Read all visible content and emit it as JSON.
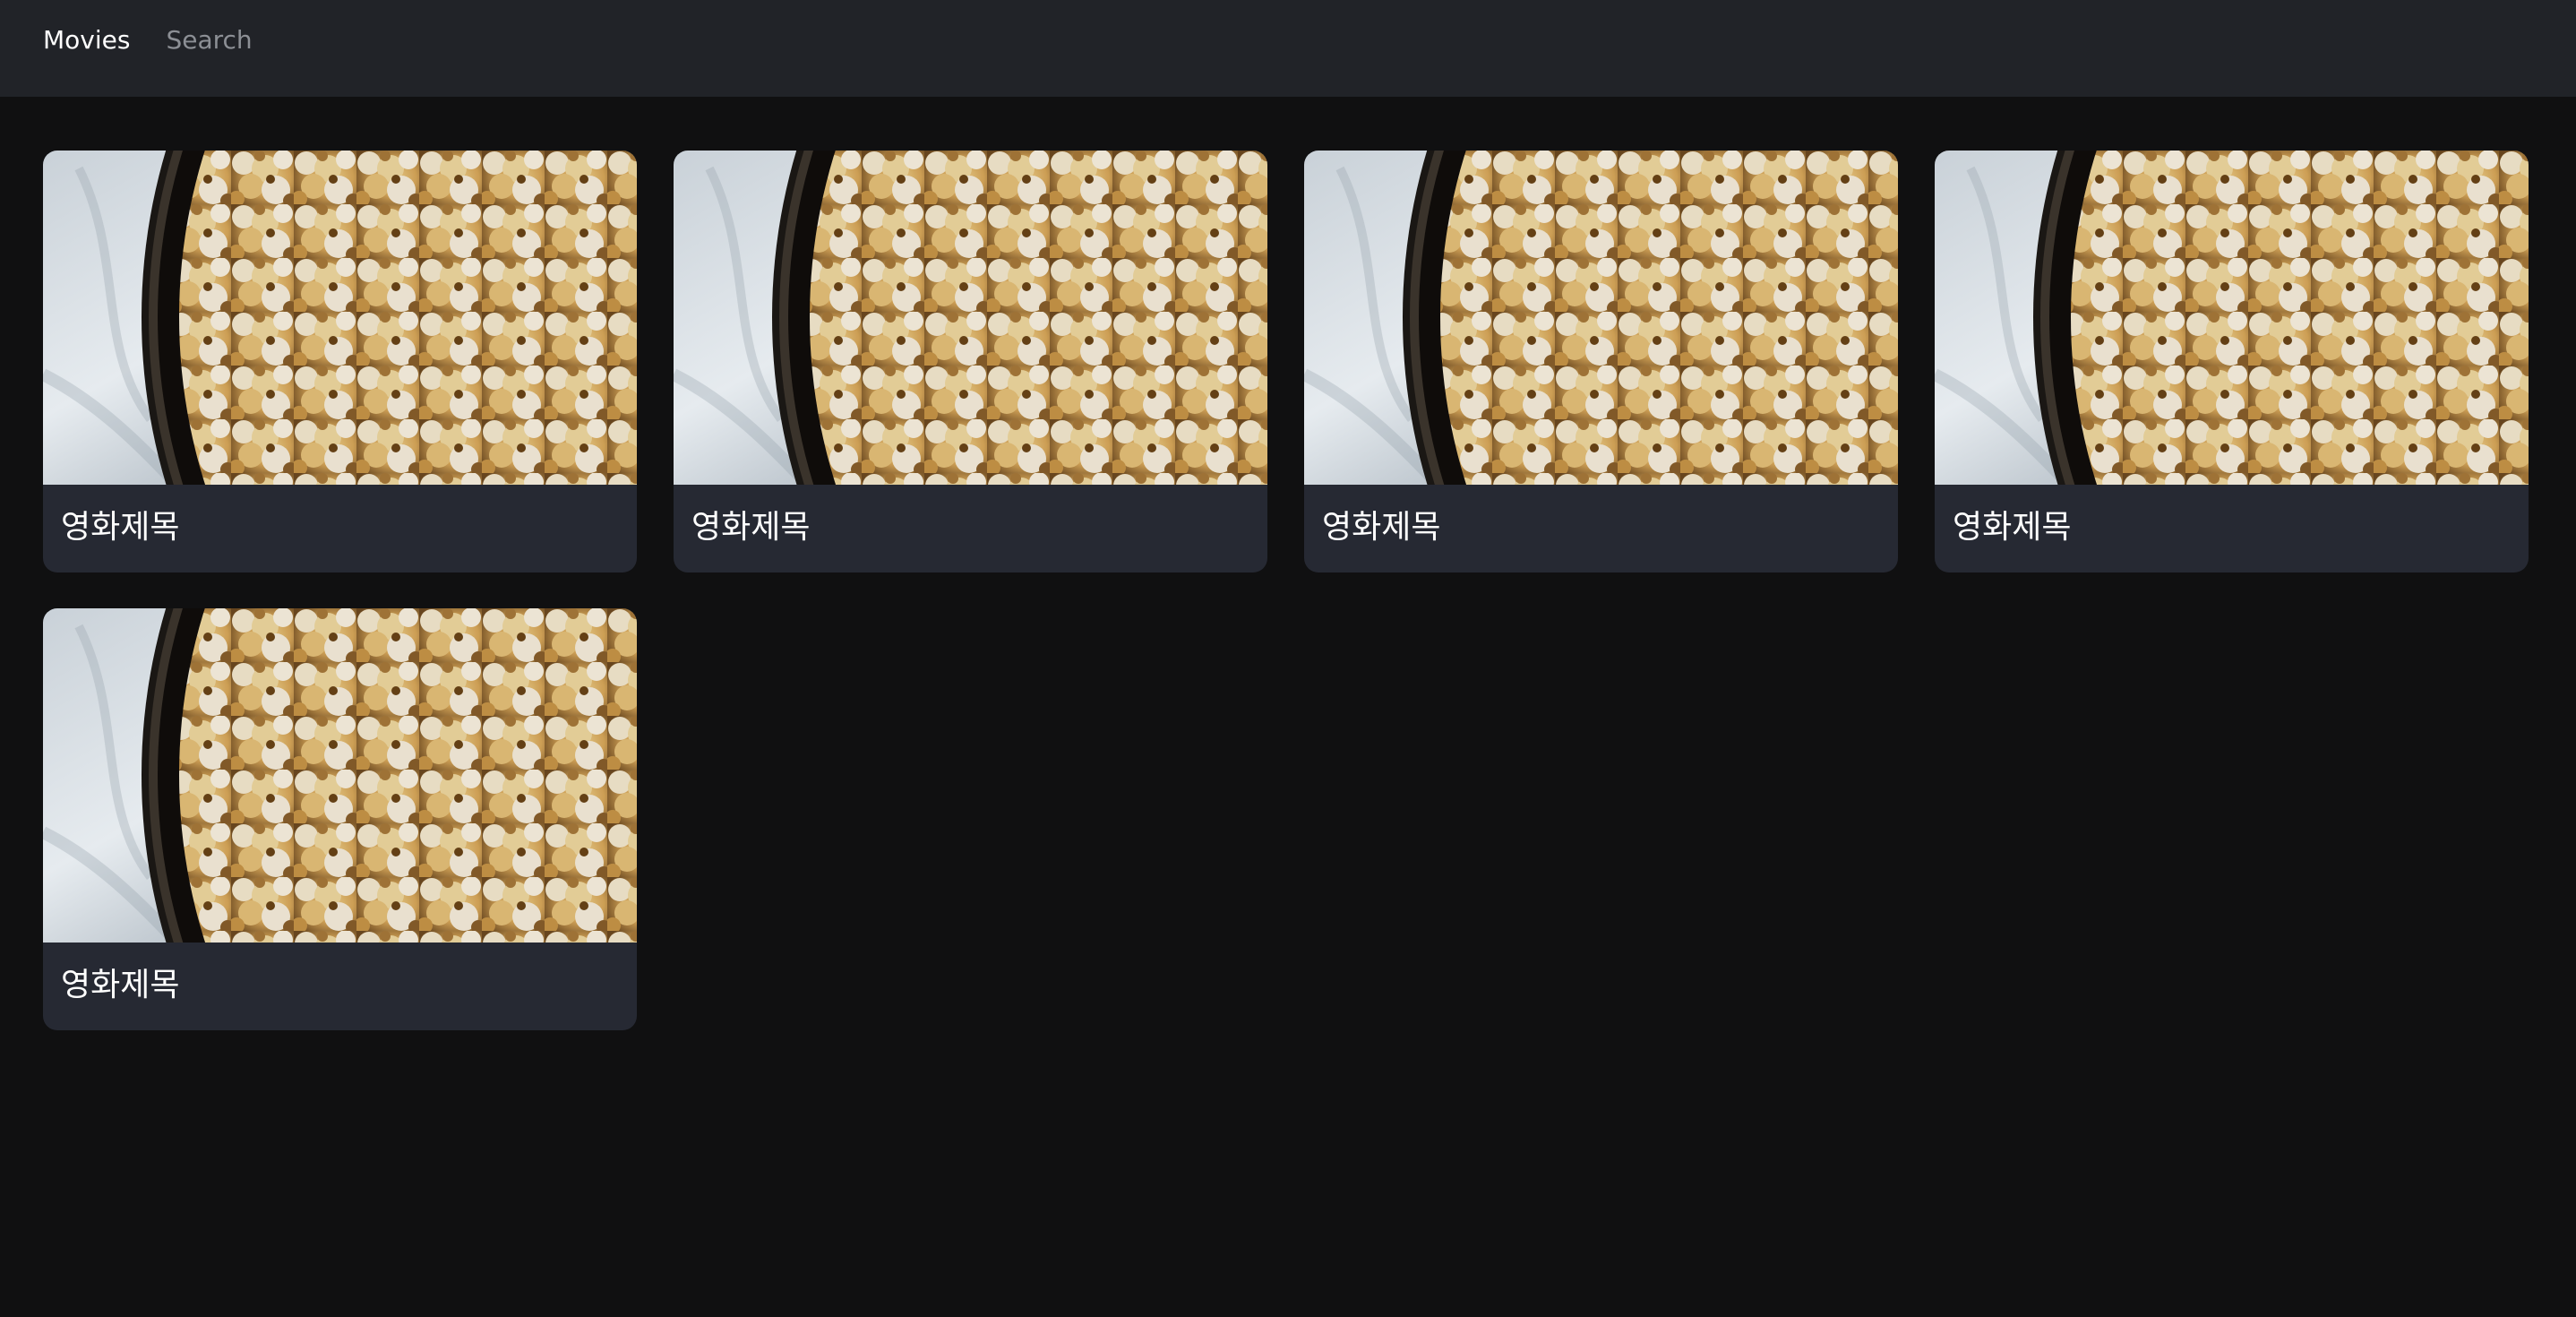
{
  "nav": {
    "links": [
      {
        "label": "Movies",
        "active": true
      },
      {
        "label": "Search",
        "active": false
      }
    ]
  },
  "movies": [
    {
      "title": "영화제목",
      "image": "popcorn-bowl-photo"
    },
    {
      "title": "영화제목",
      "image": "popcorn-bowl-photo"
    },
    {
      "title": "영화제목",
      "image": "popcorn-bowl-photo"
    },
    {
      "title": "영화제목",
      "image": "popcorn-bowl-photo"
    },
    {
      "title": "영화제목",
      "image": "popcorn-bowl-photo"
    }
  ],
  "colors": {
    "page_background": "#101011",
    "navbar_background": "#212328",
    "card_background": "#262933",
    "text_primary": "#ffffff",
    "text_muted": "#8c8f95"
  }
}
